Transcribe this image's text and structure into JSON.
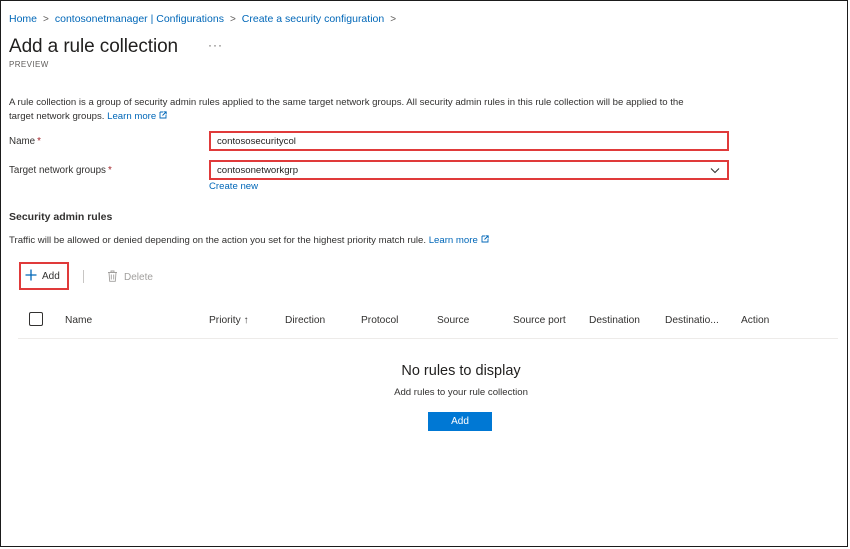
{
  "breadcrumb": {
    "items": [
      "Home",
      "contosonetmanager | Configurations",
      "Create a security configuration"
    ],
    "separator": ">"
  },
  "header": {
    "title": "Add a rule collection",
    "more": "···",
    "subtitle": "PREVIEW"
  },
  "description": {
    "text": "A rule collection is a group of security admin rules applied to the same target network groups. All security admin rules in this rule collection will be applied to the target network groups.",
    "learn_more": "Learn more"
  },
  "form": {
    "name_label": "Name",
    "name_value": "contososecuritycol",
    "required_mark": "*",
    "target_label": "Target network groups",
    "target_value": "contosonetworkgrp",
    "create_new": "Create new"
  },
  "rules": {
    "section_title": "Security admin rules",
    "traffic_text": "Traffic will be allowed or denied depending on the action you set for the highest priority match rule.",
    "learn_more": "Learn more",
    "toolbar": {
      "add_label": "Add",
      "delete_label": "Delete"
    },
    "columns": [
      "Name",
      "Priority ↑",
      "Direction",
      "Protocol",
      "Source",
      "Source port",
      "Destination",
      "Destinatio...",
      "Action"
    ],
    "empty_title": "No rules to display",
    "empty_subtitle": "Add rules to your rule collection",
    "empty_add_button": "Add"
  },
  "colors": {
    "link": "#0067b8",
    "highlight_border": "#e03a3a",
    "primary_button": "#0078d4"
  },
  "icons": {
    "external_link": "external-link-icon",
    "plus": "plus-icon",
    "trash": "trash-icon",
    "chevron": "chevron-down-icon"
  }
}
